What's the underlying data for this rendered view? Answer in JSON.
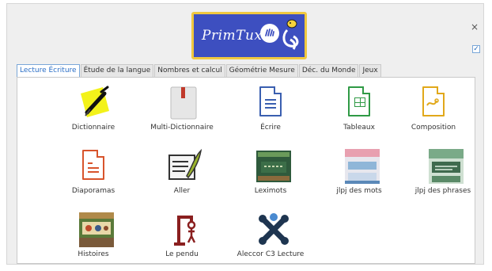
{
  "app": {
    "logo_text": "PrimTux"
  },
  "window": {
    "close_glyph": "×",
    "check_glyph": "✓"
  },
  "tabs": [
    {
      "label": "Lecture Écriture",
      "active": true
    },
    {
      "label": "Étude de la langue",
      "active": false
    },
    {
      "label": "Nombres et calcul",
      "active": false
    },
    {
      "label": "Géométrie Mesure",
      "active": false
    },
    {
      "label": "Déc. du Monde",
      "active": false
    },
    {
      "label": "Jeux",
      "active": false
    }
  ],
  "apps": [
    {
      "label": "Dictionnaire",
      "icon": "dictionary-icon"
    },
    {
      "label": "Multi-Dictionnaire",
      "icon": "multi-dictionary-icon"
    },
    {
      "label": "Écrire",
      "icon": "writer-icon"
    },
    {
      "label": "Tableaux",
      "icon": "spreadsheet-icon"
    },
    {
      "label": "Composition",
      "icon": "draw-icon"
    },
    {
      "label": "Diaporamas",
      "icon": "presentation-icon"
    },
    {
      "label": "Aller",
      "icon": "aller-icon"
    },
    {
      "label": "Leximots",
      "icon": "leximots-icon"
    },
    {
      "label": "jlpj des mots",
      "icon": "jlpj-mots-icon"
    },
    {
      "label": "jlpj des phrases",
      "icon": "jlpj-phrases-icon"
    },
    {
      "label": "Histoires",
      "icon": "histoires-icon"
    },
    {
      "label": "Le pendu",
      "icon": "hangman-icon"
    },
    {
      "label": "Aleccor C3 Lecture",
      "icon": "aleccor-icon"
    }
  ],
  "colors": {
    "accent": "#2a6ec6",
    "logo_bg": "#3d4fc0",
    "logo_border": "#f0c840"
  }
}
